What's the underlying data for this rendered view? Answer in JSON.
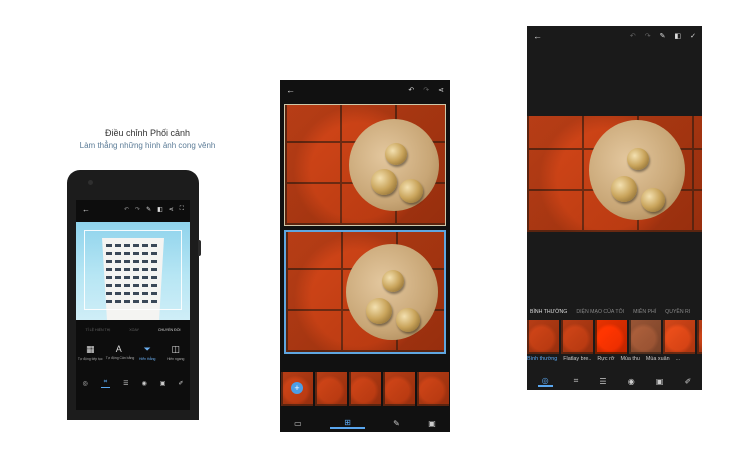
{
  "panel1": {
    "title": "Điều chỉnh Phối cảnh",
    "subtitle": "Làm thẳng những hình ảnh cong vênh",
    "tabs": [
      "TỈ LỆ HIỂN THỊ",
      "XOAY",
      "CHUYỂN ĐỔI"
    ],
    "tools": [
      {
        "label": "Tự động tiếp tục",
        "icon": "grid-icon"
      },
      {
        "label": "Tự động Cân bằng",
        "icon": "letter-a-icon",
        "glyph": "A"
      },
      {
        "label": "Hiển thẳng",
        "icon": "perspective-icon"
      },
      {
        "label": "Hiên ngang",
        "icon": "horizontal-flip-icon"
      }
    ],
    "accent": "#5aa7f0"
  },
  "panel2": {
    "accent": "#5fa6e0"
  },
  "panel3": {
    "tabs": [
      "BÌNH THƯỜNG",
      "DIỆN MẠO CỦA TÔI",
      "MIỄN PHÍ",
      "QUYỀN RI"
    ],
    "filters": [
      "Bình thường",
      "Flatlay bre..",
      "Rực rỡ",
      "Mùa thu",
      "Mùa xuân",
      "..."
    ]
  },
  "icons": {
    "back": "←",
    "undo": "↶",
    "redo": "↷",
    "share": "⋖",
    "check": "✓"
  }
}
